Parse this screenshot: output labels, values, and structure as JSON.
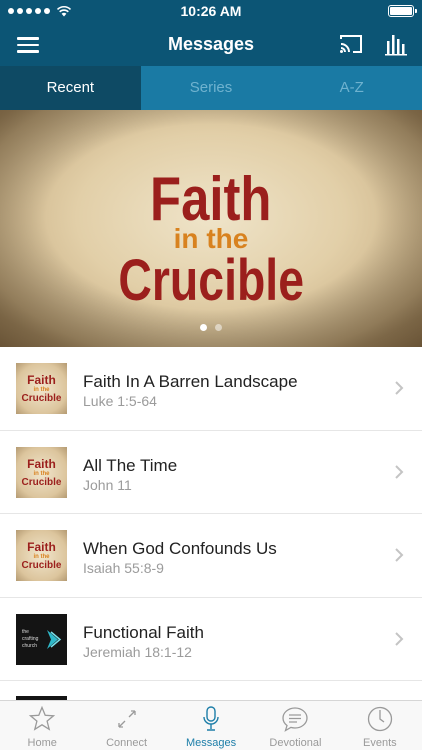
{
  "status_bar": {
    "time": "10:26 AM"
  },
  "nav": {
    "title": "Messages"
  },
  "tabs": [
    {
      "label": "Recent",
      "active": true
    },
    {
      "label": "Series",
      "active": false
    },
    {
      "label": "A-Z",
      "active": false
    }
  ],
  "hero": {
    "line1": "Faith",
    "line2": "in the",
    "line3": "Crucible",
    "pages": 2,
    "current_page": 1
  },
  "messages": [
    {
      "title": "Faith In A Barren Landscape",
      "subtitle": "Luke 1:5-64",
      "thumb": "faith"
    },
    {
      "title": "All The Time",
      "subtitle": "John 11",
      "thumb": "faith"
    },
    {
      "title": "When God Confounds Us",
      "subtitle": "Isaiah 55:8-9",
      "thumb": "faith"
    },
    {
      "title": "Functional Faith",
      "subtitle": "Jeremiah 18:1-12",
      "thumb": "dark"
    }
  ],
  "thumb_text": {
    "faith_line1": "Faith",
    "faith_line2": "in the",
    "faith_line3": "Crucible",
    "dark_line1": "the",
    "dark_line2": "crafting",
    "dark_line3": "church"
  },
  "tab_bar": [
    {
      "label": "Home",
      "icon": "star-icon",
      "active": false
    },
    {
      "label": "Connect",
      "icon": "connect-icon",
      "active": false
    },
    {
      "label": "Messages",
      "icon": "microphone-icon",
      "active": true
    },
    {
      "label": "Devotional",
      "icon": "speech-bubble-icon",
      "active": false
    },
    {
      "label": "Events",
      "icon": "clock-icon",
      "active": false
    }
  ],
  "colors": {
    "nav_background": "#0c5575",
    "tab_background": "#1a7aa4",
    "tab_active_background": "#0e4a64",
    "accent": "#1d7ea8",
    "hero_title_red": "#9b1f1c",
    "hero_title_orange": "#d8821f"
  }
}
